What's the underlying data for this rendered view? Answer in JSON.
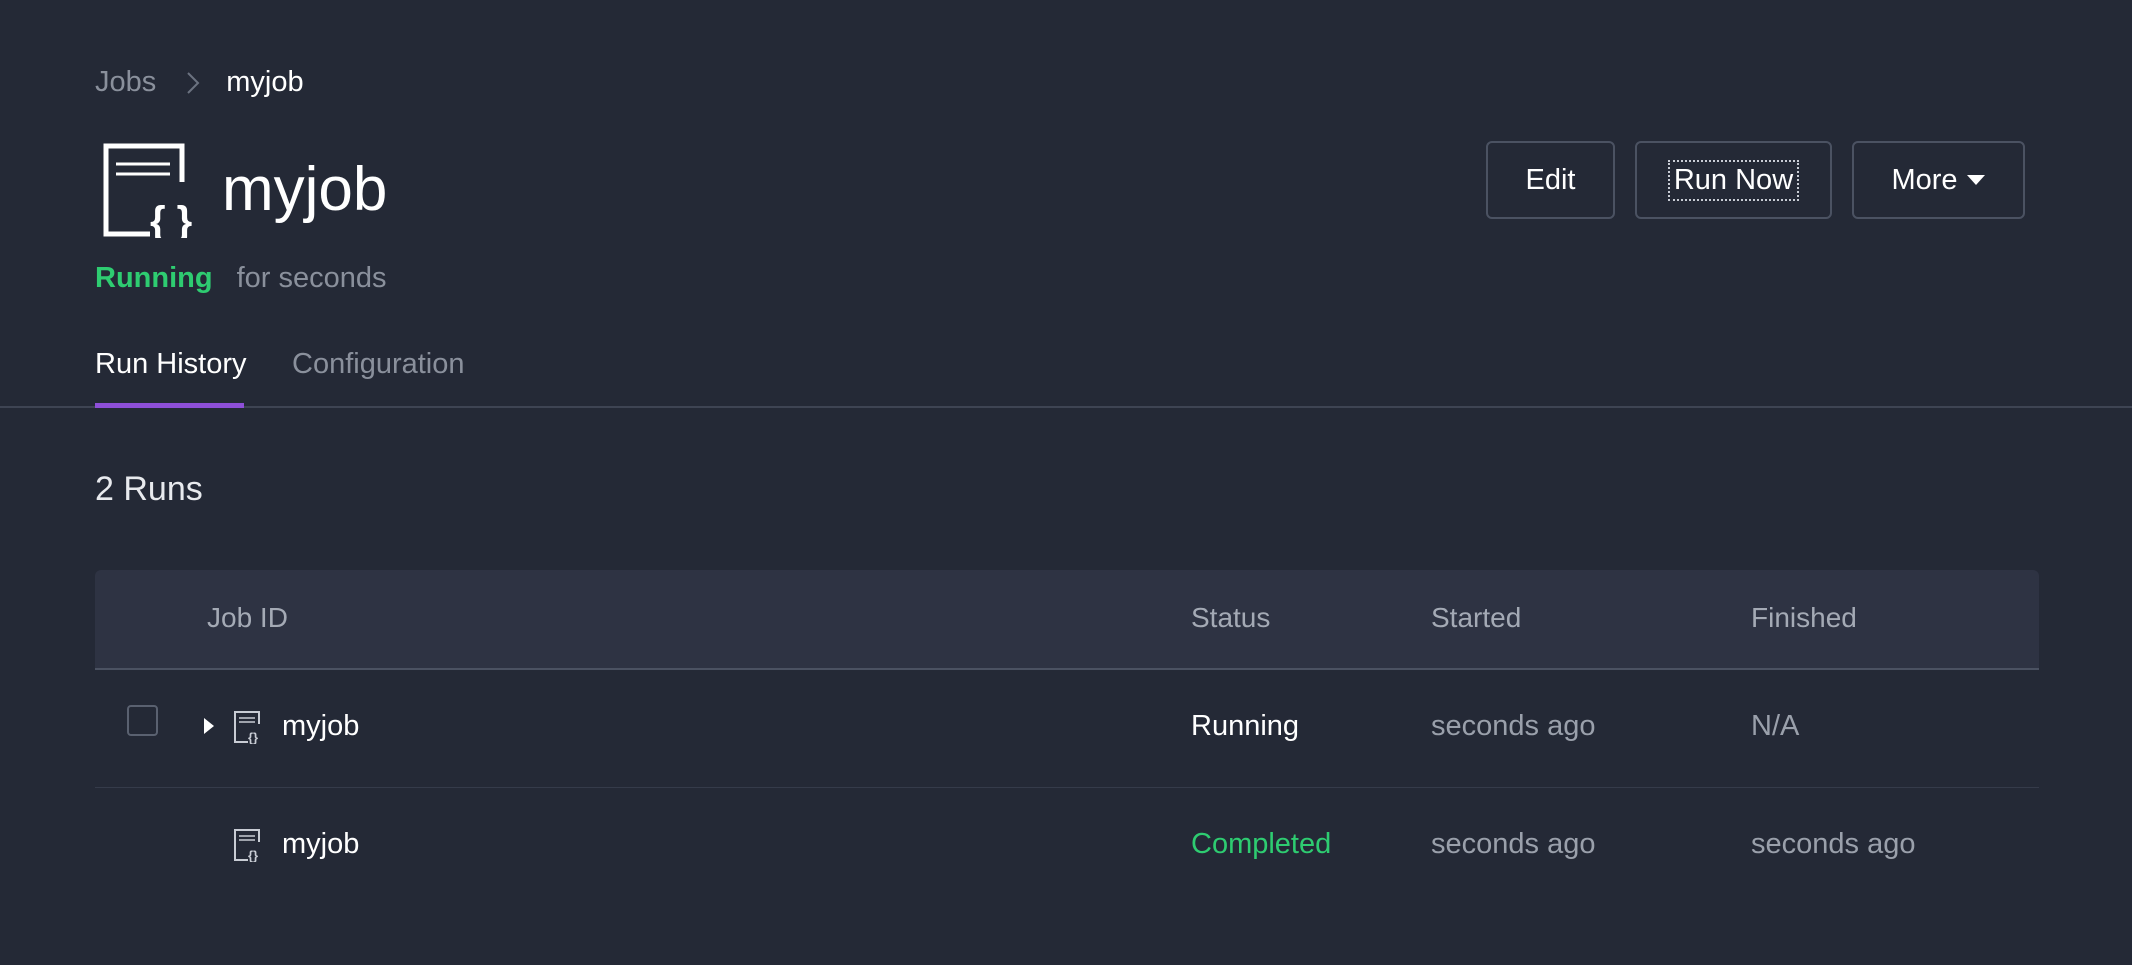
{
  "breadcrumb": {
    "parent": "Jobs",
    "current": "myjob"
  },
  "header": {
    "title": "myjob",
    "status": "Running",
    "status_duration": "for seconds",
    "status_color": "#2ecc71",
    "buttons": {
      "edit": "Edit",
      "run_now": "Run Now",
      "more": "More"
    }
  },
  "tabs": {
    "run_history": "Run History",
    "configuration": "Configuration",
    "active": "run_history",
    "accent": "#8e4fd8"
  },
  "runs": {
    "count_label": "2 Runs",
    "columns": {
      "job_id": "Job ID",
      "status": "Status",
      "started": "Started",
      "finished": "Finished"
    },
    "rows": [
      {
        "name": "myjob",
        "status": "Running",
        "started": "seconds ago",
        "finished": "N/A",
        "expandable": true,
        "selectable": true
      },
      {
        "name": "myjob",
        "status": "Completed",
        "started": "seconds ago",
        "finished": "seconds ago",
        "expandable": false,
        "selectable": false
      }
    ]
  },
  "icons": {
    "job": "json-document-icon",
    "chevron": "chevron-right-icon",
    "caret": "caret-down-icon",
    "expand": "triangle-right-icon"
  },
  "colors": {
    "background": "#242936",
    "completed": "#2ecc71",
    "muted": "#8a909c"
  }
}
